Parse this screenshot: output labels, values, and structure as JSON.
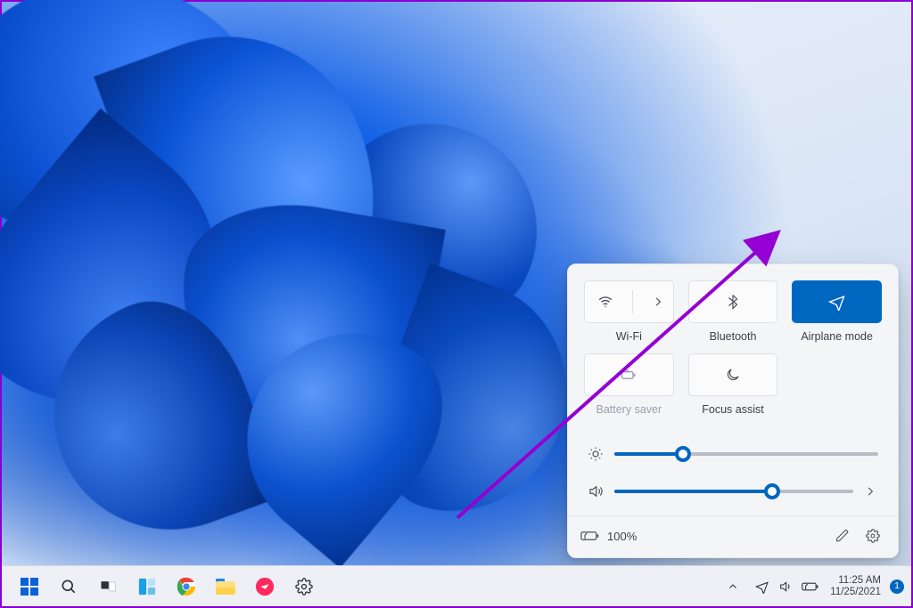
{
  "quick_settings": {
    "tiles": {
      "wifi": {
        "label": "Wi-Fi",
        "active": false
      },
      "bluetooth": {
        "label": "Bluetooth",
        "active": false
      },
      "airplane": {
        "label": "Airplane mode",
        "active": true
      },
      "battery_saver": {
        "label": "Battery saver",
        "enabled": false
      },
      "focus_assist": {
        "label": "Focus assist",
        "active": false
      }
    },
    "brightness_percent": 26,
    "volume_percent": 66,
    "footer": {
      "battery_text": "100%"
    }
  },
  "taskbar": {
    "clock": {
      "time": "11:25 AM",
      "date": "11/25/2021"
    },
    "notification_count": "1"
  }
}
